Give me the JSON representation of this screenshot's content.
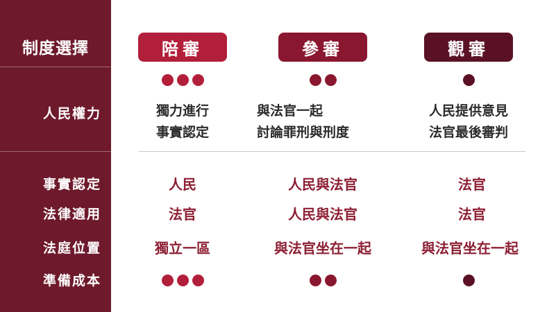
{
  "sidebar": {
    "title": "制度選擇",
    "labels": [
      "人民權力",
      "事實認定",
      "法律適用",
      "法庭位置",
      "準備成本"
    ]
  },
  "colors": {
    "sidebar_bg": "#6e1a2c",
    "col1": "#b21f3b",
    "col2": "#8a1730",
    "col3": "#5a1126",
    "text_accent": "#8c1f33"
  },
  "columns": [
    {
      "title": "陪審",
      "dots": 3,
      "power_line1": "獨力進行",
      "power_line2": "事實認定",
      "fact_finding": "人民",
      "law_application": "法官",
      "court_position": "獨立一區",
      "cost_dots": 3
    },
    {
      "title": "參審",
      "dots": 2,
      "power_line1": "與法官一起",
      "power_line2": "討論罪刑與刑度",
      "fact_finding": "人民與法官",
      "law_application": "人民與法官",
      "court_position": "與法官坐在一起",
      "cost_dots": 2
    },
    {
      "title": "觀審",
      "dots": 1,
      "power_line1": "人民提供意見",
      "power_line2": "法官最後審判",
      "fact_finding": "法官",
      "law_application": "法官",
      "court_position": "與法官坐在一起",
      "cost_dots": 1
    }
  ]
}
